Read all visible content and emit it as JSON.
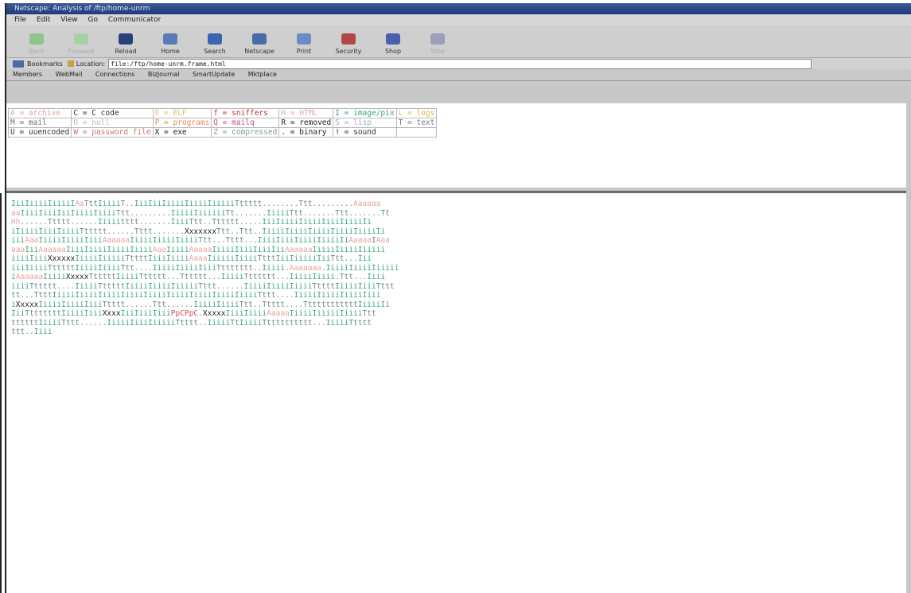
{
  "window": {
    "title": "Netscape: Analysis of /ftp/home-unrm"
  },
  "menu": [
    "File",
    "Edit",
    "View",
    "Go",
    "Communicator"
  ],
  "toolbar": [
    {
      "label": "Back",
      "icon": "back-arrow-icon",
      "enabled": false
    },
    {
      "label": "Forward",
      "icon": "forward-arrow-icon",
      "enabled": false
    },
    {
      "label": "Reload",
      "icon": "reload-icon",
      "enabled": true
    },
    {
      "label": "Home",
      "icon": "home-icon",
      "enabled": true
    },
    {
      "label": "Search",
      "icon": "search-icon",
      "enabled": true
    },
    {
      "label": "Netscape",
      "icon": "netscape-icon",
      "enabled": true
    },
    {
      "label": "Print",
      "icon": "print-icon",
      "enabled": true
    },
    {
      "label": "Security",
      "icon": "security-lock-icon",
      "enabled": true
    },
    {
      "label": "Shop",
      "icon": "shop-icon",
      "enabled": true
    },
    {
      "label": "Stop",
      "icon": "stop-icon",
      "enabled": false
    }
  ],
  "location": {
    "bookmarks": "Bookmarks",
    "label": "Location:",
    "url": "file:/ftp/home-unrm.frame.html"
  },
  "personal_toolbar": [
    "Members",
    "WebMail",
    "Connections",
    "BizJournal",
    "SmartUpdate",
    "Mktplace"
  ],
  "legend": [
    [
      {
        "t": "A = archive",
        "c": "#e6a39a"
      },
      {
        "t": "C = C code",
        "c": "#333333"
      },
      {
        "t": "E = ELF",
        "c": "#e3c06a"
      },
      {
        "t": "f = sniffers",
        "c": "#c03535"
      },
      {
        "t": "H = HTML",
        "c": "#e6a0c8"
      },
      {
        "t": "I = image/pix",
        "c": "#3aa57a"
      },
      {
        "t": "L = logs",
        "c": "#e0b640"
      }
    ],
    [
      {
        "t": "M = mail",
        "c": "#6e6e6e"
      },
      {
        "t": "O = null",
        "c": "#bbbbbb"
      },
      {
        "t": "P = programs",
        "c": "#e08a5a"
      },
      {
        "t": "Q = mailq",
        "c": "#c0508a"
      },
      {
        "t": "R = removed",
        "c": "#222222"
      },
      {
        "t": "S = lisp",
        "c": "#8fb0d8"
      },
      {
        "t": "T = text",
        "c": "#7a7a7a"
      }
    ],
    [
      {
        "t": "U = uuencoded",
        "c": "#333333"
      },
      {
        "t": "W = password file",
        "c": "#d47070"
      },
      {
        "t": "X = exe",
        "c": "#222222"
      },
      {
        "t": "Z = compressed",
        "c": "#7aa0a0"
      },
      {
        "t": ". = binary",
        "c": "#222222"
      },
      {
        "t": "! = sound",
        "c": "#333333"
      },
      {
        "t": "",
        "c": "#333333"
      }
    ]
  ],
  "viz_lines": [
    "IiiIiiiiIiiiiIAaTttIiiiiT..IiiIiiIiiiiIiiiiIiiiiiTttttt........Ttt.........Aaaaaa",
    "aaIiiiIiiiIiiIiiiiIiiiiTtt.........IiiiiIiiiiiiTt.......IiiiiTtt.......Ttt.......Tt",
    "Hh......Ttttt......Iiiiitttt.......IiiiTtt..Tttttt.....IiiIiiiiIiiiiIiiiIiiiiIi",
    "iIiiiiIiiiIiiiiTttttt......Tttt.......XxxxxxxTtt..Ttt..IiiiiIiiiiIiiiiIiiiiIiiiiIi",
    "iiiAaaIiiiiIiiiiIiiiAaaaaaIiiiiIiiiiIiiiiTtt...Tttt...IiiiIiiiIiiiiIiiiiIiAaaaaIAaa",
    "aaaIiiAaaaaaIiiiIiiiiIiiiiIiiiiAaaIiiiiAaaaaIiiiiIiiiIiiiIiiAaaaaaIiiiiIiiiiIiiiii",
    "iiiiIiiiXxxxxxIiiiiIiiiiiTttttIiiiIiiiiAaaaIiiiiiIiiiiTtttIiiIiiiiiIiiTtt...Iii",
    "iiiIiiiiTtttttIiiiiIiiiiTtt....IiiiiIiiiiIiiiTttttttt..Iiiii.Aaaaaaa.IiiiiIiiiiIiiiii",
    "iAaaaaaIiiiiXxxxxTtttttIiiiiTttttt...Tttttt...IiiiiTtttttt...IiiiiIiiii.Ttt...Iiii",
    "iiiiTttttt....IiiiiTtttttIiiiiIiiiiIiiiiiTttt......IiiiiIiiiiIiiiiTttttIiiiiIiiiTttt",
    "tt...TtttIiiiiIiiiiIiiiiIiiiiIiiiiIiiiiIiiiiIiiiiIiiiiTttt....IiiiiIiiiiIiiiiIiii",
    "iXxxxxIiiiiIiiiiIiiiTtttt......Ttt......IiiiiIiiiiTtt..Ttttt....TtttttttttttIiiiiIi",
    "IiiTtttttttIiiiiIiiiXxxxIiiIiiiIiiiPpCPpC.XxxxxIiiiIiiiiAaaaaIiiiiIiiiiiIiiiiTtt",
    "ttttttIiiiiTttt......IiiiiIiiiIiiiiiTtttt..IiiiiTtIiiiiTtttttttttt...IiiiiTtttt",
    "ttt..Iiii"
  ],
  "viz_colors": {
    "I": "#3aa57a",
    "i": "#3aa57a",
    "T": "#6a8a8a",
    "t": "#6a8a8a",
    "A": "#e6a39a",
    "a": "#e6a39a",
    "X": "#222222",
    "x": "#222222",
    "H": "#e6a0c8",
    "h": "#e6a0c8",
    "P": "#d05050",
    "p": "#d05050",
    "C": "#d05050",
    ".": "#8a8a8a"
  }
}
